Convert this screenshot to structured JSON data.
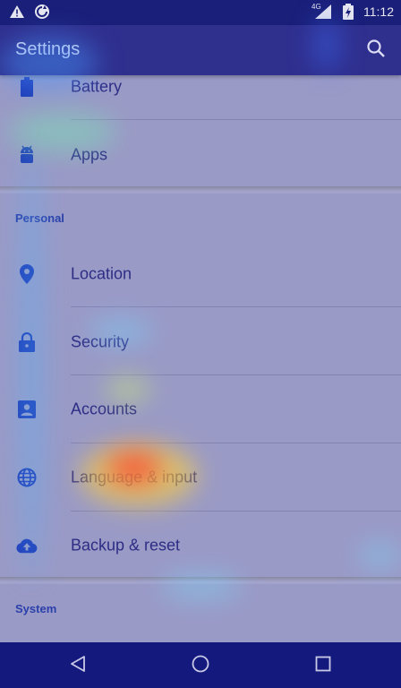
{
  "status_bar": {
    "time": "11:12",
    "network": "4G",
    "left_icons": [
      "warning-icon",
      "sync-icon"
    ],
    "right_icons": [
      "signal-icon",
      "battery-charging-icon"
    ]
  },
  "app_bar": {
    "title": "Settings",
    "search_icon": "search-icon"
  },
  "sections": {
    "device_items": [
      {
        "label": "Battery",
        "icon": "battery-icon"
      },
      {
        "label": "Apps",
        "icon": "android-icon"
      }
    ],
    "personal": {
      "header": "Personal",
      "items": [
        {
          "label": "Location",
          "icon": "location-pin-icon"
        },
        {
          "label": "Security",
          "icon": "lock-icon"
        },
        {
          "label": "Accounts",
          "icon": "account-box-icon"
        },
        {
          "label": "Language & input",
          "icon": "globe-icon"
        },
        {
          "label": "Backup & reset",
          "icon": "cloud-upload-icon"
        }
      ]
    },
    "system": {
      "header": "System"
    }
  },
  "nav_bar": {
    "back_icon": "back-icon",
    "home_icon": "home-icon",
    "recents_icon": "recents-icon"
  },
  "colors": {
    "status_bar": "#1a1f7a",
    "app_bar": "#2f2f8e",
    "list_bg": "#9a9ac6",
    "icon_blue": "#1f3bb8",
    "section_header": "#2a3faa"
  }
}
